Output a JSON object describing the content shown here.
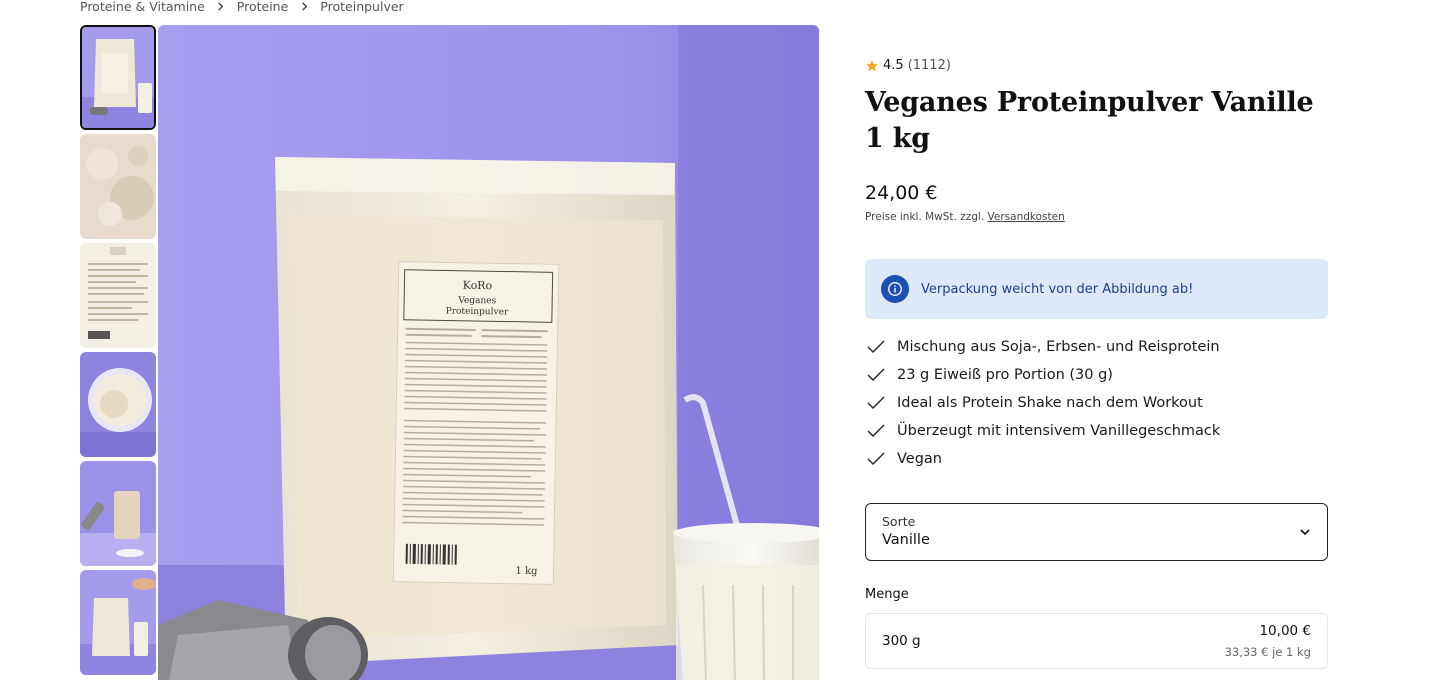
{
  "breadcrumb": {
    "items": [
      "Proteine & Vitamine",
      "Proteine",
      "Proteinpulver"
    ]
  },
  "gallery": {
    "thumbnails": [
      "product-front",
      "powder-closeup",
      "nutrition-label",
      "bowl-topview",
      "shake-dumbbell",
      "scoop-pour"
    ],
    "active_index": 0,
    "main_image": "product-bag-with-shake",
    "package_text": {
      "brand": "KoRo",
      "name_line1": "Veganes",
      "name_line2": "Proteinpulver",
      "weight": "1 kg"
    }
  },
  "product": {
    "rating": "4.5",
    "reviews": "(1112)",
    "title": "Veganes Proteinpulver Vanille 1 kg",
    "price": "24,00 €",
    "price_note": "Preise inkl. MwSt. zzgl.",
    "shipping_link": "Versandkosten",
    "notice": "Verpackung weicht von der Abbildung ab!",
    "features": [
      "Mischung aus Soja-, Erbsen- und Reisprotein",
      "23 g Eiweiß pro Portion (30 g)",
      "Ideal als Protein Shake nach dem Workout",
      "Überzeugt mit intensivem Vanillegeschmack",
      "Vegan"
    ],
    "variant": {
      "label": "Sorte",
      "value": "Vanille"
    },
    "quantity": {
      "label": "Menge",
      "options": [
        {
          "size": "300 g",
          "price": "10,00 €",
          "unit_price": "33,33 € je 1 kg"
        }
      ]
    }
  },
  "colors": {
    "accent_blue": "#1e4fb3",
    "notice_bg": "#dde9fb",
    "star": "#f5a623",
    "background_purple": "#9b8fe6"
  }
}
